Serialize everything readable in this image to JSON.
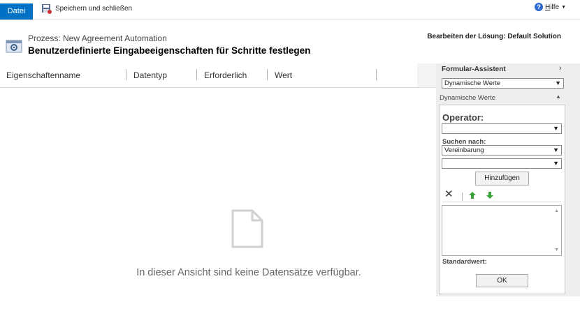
{
  "ribbon": {
    "file_tab": "Datei",
    "save_close": "Speichern und schließen",
    "help_hotkey": "H",
    "help_rest": "ilfe"
  },
  "header": {
    "process_line": "Prozess: New Agreement Automation",
    "title": "Benutzerdefinierte Eingabeeigenschaften für Schritte festlegen",
    "solution": "Bearbeiten der Lösung: Default Solution"
  },
  "grid": {
    "columns": [
      "Eigenschaftenname",
      "Datentyp",
      "Erforderlich",
      "Wert"
    ],
    "empty_message": "In dieser Ansicht sind keine Datensätze verfügbar."
  },
  "assistant": {
    "title": "Formular-Assistent",
    "mode_select_value": "Dynamische Werte",
    "section_label": "Dynamische Werte",
    "operator_label": "Operator:",
    "operator_value": "",
    "search_label": "Suchen nach:",
    "search_value": "Vereinbarung",
    "field_value": "",
    "add_button": "Hinzufügen",
    "default_label": "Standardwert:",
    "ok_button": "OK"
  },
  "colors": {
    "accent": "#0072c6",
    "sidebar_bg": "#eeeeee",
    "arrow_green": "#3aa33a"
  },
  "icons": {
    "save": "save-close-icon",
    "help": "help-icon",
    "process": "process-gear-icon",
    "empty": "empty-document-icon",
    "delete": "close-x-icon",
    "up": "move-up-arrow-icon",
    "down": "move-down-arrow-icon"
  }
}
